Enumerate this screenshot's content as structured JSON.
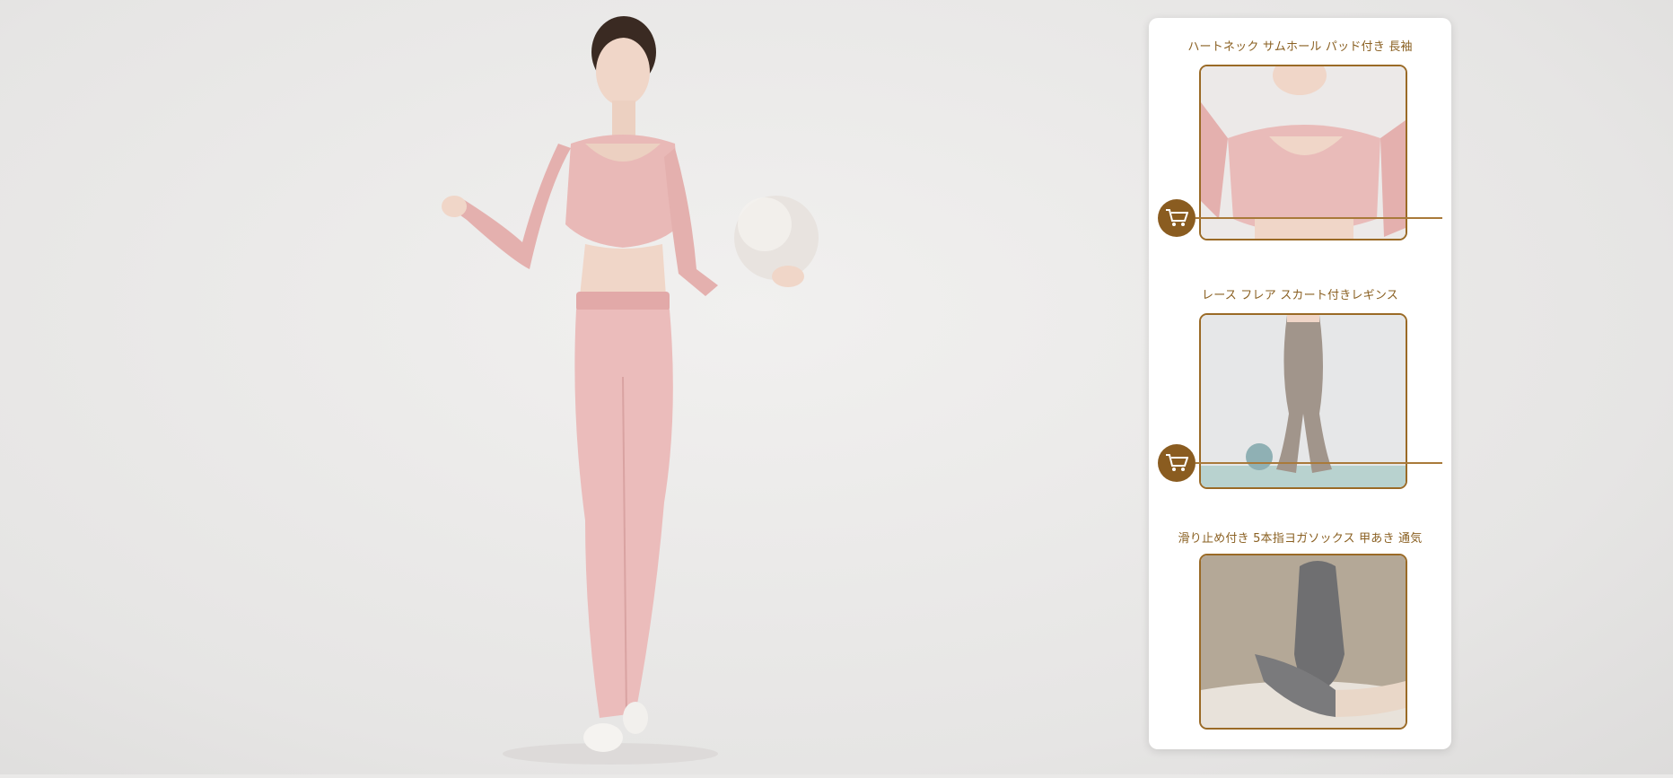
{
  "scene": {
    "hero_alt": "model in pink long-sleeve top and flare leggings holding a ball"
  },
  "products": [
    {
      "title": "ハートネック サムホール パッド付き 長袖",
      "image_name": "pink-top-photo",
      "icon": "cart-icon"
    },
    {
      "title": "レース フレア スカート付きレギンス",
      "image_name": "flare-leggings-photo",
      "icon": "cart-icon"
    },
    {
      "title": "滑り止め付き 5本指ヨガソックス 甲あき 通気",
      "image_name": "toe-socks-photo"
    }
  ],
  "colors": {
    "accent": "#8a5c20",
    "title_text": "#8a6022",
    "top_pink": "#e9b9b7",
    "legging_taupe": "#a1958b",
    "sock_grey": "#6f6f71"
  }
}
